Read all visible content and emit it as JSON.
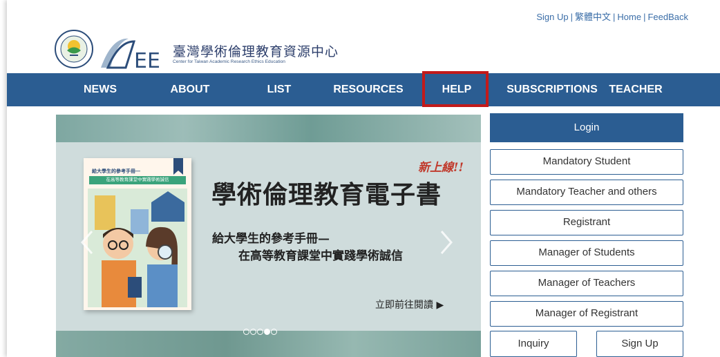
{
  "top_links": {
    "sign_up": "Sign Up",
    "lang": "繁體中文",
    "home": "Home",
    "feedback": "FeedBack",
    "separator": "|"
  },
  "logo": {
    "title_cn": "臺灣學術倫理教育資源中心",
    "title_en": "Center for Taiwan Academic Research Ethics Education",
    "seal_text": "MINISTRY OF EDUCATION",
    "seal_cn": "教育部",
    "mark_text": "AREE"
  },
  "nav": {
    "items": [
      {
        "label": "NEWS"
      },
      {
        "label": "ABOUT"
      },
      {
        "label": "LIST"
      },
      {
        "label": "RESOURCES"
      },
      {
        "label": "HELP",
        "highlighted": true
      },
      {
        "label": "SUBSCRIPTIONS"
      },
      {
        "label": "TEACHER"
      }
    ],
    "bg_color": "#2b5d92",
    "highlight_color": "#c21a1a"
  },
  "banner": {
    "new_tag": "新上線!!",
    "title": "學術倫理教育電子書",
    "subtitle_1": "給大學生的參考手冊—",
    "subtitle_2": "在高等教育課堂中實踐學術誠信",
    "read_now": "立即前往閱讀 ▶",
    "book_line_1": "給大學生的參考手冊—",
    "book_line_2": "在高等教育課堂中實踐學術誠信",
    "slide_count": 4,
    "active_slide": 3
  },
  "login": {
    "title": "Login",
    "roles": [
      "Mandatory Student",
      "Mandatory Teacher and others",
      "Registrant",
      "Manager of Students",
      "Manager of Teachers",
      "Manager of Registrant"
    ],
    "inquiry": "Inquiry",
    "sign_up": "Sign Up"
  }
}
